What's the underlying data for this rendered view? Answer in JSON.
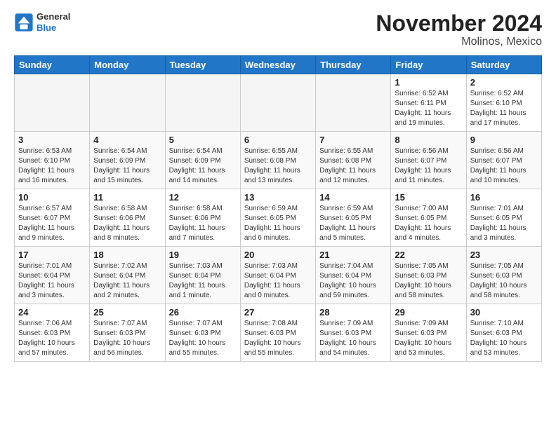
{
  "header": {
    "logo_general": "General",
    "logo_blue": "Blue",
    "title": "November 2024",
    "subtitle": "Molinos, Mexico"
  },
  "days_of_week": [
    "Sunday",
    "Monday",
    "Tuesday",
    "Wednesday",
    "Thursday",
    "Friday",
    "Saturday"
  ],
  "weeks": [
    [
      {
        "day": "",
        "info": ""
      },
      {
        "day": "",
        "info": ""
      },
      {
        "day": "",
        "info": ""
      },
      {
        "day": "",
        "info": ""
      },
      {
        "day": "",
        "info": ""
      },
      {
        "day": "1",
        "info": "Sunrise: 6:52 AM\nSunset: 6:11 PM\nDaylight: 11 hours and 19 minutes."
      },
      {
        "day": "2",
        "info": "Sunrise: 6:52 AM\nSunset: 6:10 PM\nDaylight: 11 hours and 17 minutes."
      }
    ],
    [
      {
        "day": "3",
        "info": "Sunrise: 6:53 AM\nSunset: 6:10 PM\nDaylight: 11 hours and 16 minutes."
      },
      {
        "day": "4",
        "info": "Sunrise: 6:54 AM\nSunset: 6:09 PM\nDaylight: 11 hours and 15 minutes."
      },
      {
        "day": "5",
        "info": "Sunrise: 6:54 AM\nSunset: 6:09 PM\nDaylight: 11 hours and 14 minutes."
      },
      {
        "day": "6",
        "info": "Sunrise: 6:55 AM\nSunset: 6:08 PM\nDaylight: 11 hours and 13 minutes."
      },
      {
        "day": "7",
        "info": "Sunrise: 6:55 AM\nSunset: 6:08 PM\nDaylight: 11 hours and 12 minutes."
      },
      {
        "day": "8",
        "info": "Sunrise: 6:56 AM\nSunset: 6:07 PM\nDaylight: 11 hours and 11 minutes."
      },
      {
        "day": "9",
        "info": "Sunrise: 6:56 AM\nSunset: 6:07 PM\nDaylight: 11 hours and 10 minutes."
      }
    ],
    [
      {
        "day": "10",
        "info": "Sunrise: 6:57 AM\nSunset: 6:07 PM\nDaylight: 11 hours and 9 minutes."
      },
      {
        "day": "11",
        "info": "Sunrise: 6:58 AM\nSunset: 6:06 PM\nDaylight: 11 hours and 8 minutes."
      },
      {
        "day": "12",
        "info": "Sunrise: 6:58 AM\nSunset: 6:06 PM\nDaylight: 11 hours and 7 minutes."
      },
      {
        "day": "13",
        "info": "Sunrise: 6:59 AM\nSunset: 6:05 PM\nDaylight: 11 hours and 6 minutes."
      },
      {
        "day": "14",
        "info": "Sunrise: 6:59 AM\nSunset: 6:05 PM\nDaylight: 11 hours and 5 minutes."
      },
      {
        "day": "15",
        "info": "Sunrise: 7:00 AM\nSunset: 6:05 PM\nDaylight: 11 hours and 4 minutes."
      },
      {
        "day": "16",
        "info": "Sunrise: 7:01 AM\nSunset: 6:05 PM\nDaylight: 11 hours and 3 minutes."
      }
    ],
    [
      {
        "day": "17",
        "info": "Sunrise: 7:01 AM\nSunset: 6:04 PM\nDaylight: 11 hours and 3 minutes."
      },
      {
        "day": "18",
        "info": "Sunrise: 7:02 AM\nSunset: 6:04 PM\nDaylight: 11 hours and 2 minutes."
      },
      {
        "day": "19",
        "info": "Sunrise: 7:03 AM\nSunset: 6:04 PM\nDaylight: 11 hours and 1 minute."
      },
      {
        "day": "20",
        "info": "Sunrise: 7:03 AM\nSunset: 6:04 PM\nDaylight: 11 hours and 0 minutes."
      },
      {
        "day": "21",
        "info": "Sunrise: 7:04 AM\nSunset: 6:04 PM\nDaylight: 10 hours and 59 minutes."
      },
      {
        "day": "22",
        "info": "Sunrise: 7:05 AM\nSunset: 6:03 PM\nDaylight: 10 hours and 58 minutes."
      },
      {
        "day": "23",
        "info": "Sunrise: 7:05 AM\nSunset: 6:03 PM\nDaylight: 10 hours and 58 minutes."
      }
    ],
    [
      {
        "day": "24",
        "info": "Sunrise: 7:06 AM\nSunset: 6:03 PM\nDaylight: 10 hours and 57 minutes."
      },
      {
        "day": "25",
        "info": "Sunrise: 7:07 AM\nSunset: 6:03 PM\nDaylight: 10 hours and 56 minutes."
      },
      {
        "day": "26",
        "info": "Sunrise: 7:07 AM\nSunset: 6:03 PM\nDaylight: 10 hours and 55 minutes."
      },
      {
        "day": "27",
        "info": "Sunrise: 7:08 AM\nSunset: 6:03 PM\nDaylight: 10 hours and 55 minutes."
      },
      {
        "day": "28",
        "info": "Sunrise: 7:09 AM\nSunset: 6:03 PM\nDaylight: 10 hours and 54 minutes."
      },
      {
        "day": "29",
        "info": "Sunrise: 7:09 AM\nSunset: 6:03 PM\nDaylight: 10 hours and 53 minutes."
      },
      {
        "day": "30",
        "info": "Sunrise: 7:10 AM\nSunset: 6:03 PM\nDaylight: 10 hours and 53 minutes."
      }
    ]
  ]
}
